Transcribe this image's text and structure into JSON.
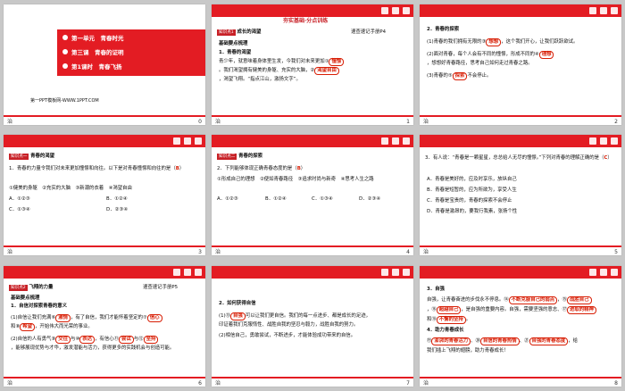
{
  "slides": [
    {
      "num": "0",
      "lines": [
        "第一单元　青春时光",
        "第三课　青春的证明",
        "第1课时　青春飞扬"
      ],
      "foot": "第一PPT模板网-WWW.1PPT.COM"
    },
    {
      "num": "1",
      "header": "夯实基础·分点训练",
      "tag": "知识点1",
      "title": "成长的渴望",
      "note": "速查速记手册P4",
      "sub": "基础要点梳理",
      "item": "1．青春的渴望",
      "body1": "青少年，就意味着身体里生发，今我们对未来更加①",
      "ans1": "憧憬",
      "body2": "。我们渴望拥有健美的身躯、充实的大脑，②",
      "ans2": "渴望自由",
      "body3": "，渴望飞翔。“指点江山，激扬文字”。"
    },
    {
      "num": "2",
      "item": "2．青春的探索",
      "l1a": "(1)青春的我们拥有无限的③",
      "l1b": "想想",
      "l1c": "，这个我们开心，让我们跃跃欲试。",
      "l2a": "(2)面对青春，每个人会有不同的憧憬，形成不同的④",
      "l2b": "理想",
      "l2c": "，想想好青春路径，思考自己如何走过青春之路。",
      "l3a": "(3)青春的⑤",
      "l3b": "探索",
      "l3c": "不会停止。"
    },
    {
      "num": "3",
      "tag": "知识点一",
      "title": "青春的渴望",
      "q": "1．青春的力量令我们对未来更加憧憬和向往。以下是对青春憧憬和向往的是（",
      "ans": "B",
      "opts": [
        "①健美的身躯　②充实的大脑　③新潮的衣着　④渴望自由",
        "A．①②③",
        "B．①②④",
        "C．①③④",
        "D．②③④"
      ]
    },
    {
      "num": "4",
      "tag": "知识点二",
      "title": "青春的探索",
      "q": "2．下列能够体现正确青春态度的是（",
      "ans": "B",
      "opts": [
        "①形成自己的理想　②便如青春路径　③追求时尚与新奇　④思考人生之路",
        "A．①②③",
        "B．①②④",
        "C．①③④",
        "D．②③④"
      ]
    },
    {
      "num": "5",
      "q": "3．有人说：“青春是一颗星星，总总给人无尽的憧憬。”下列对青春的理解正确的是（",
      "ans": "C",
      "opts": [
        "A．青春是美好的，应及时享乐，放纵自己",
        "B．青春是短暂的，应为所欲为，享受人生",
        "C．青春是宝贵的，青春的探索不会停止",
        "D．青春是激昂的，要我行我素，张扬个性"
      ]
    },
    {
      "num": "6",
      "tag": "知识点2",
      "title": "飞翔的力量",
      "note": "速查速记手册P5",
      "sub": "基础要点梳理",
      "item": "1．自信对探索青春的意义",
      "l1a": "(1)自信让我们充满⑥",
      "l1b": "激情",
      "l1c": "，有了自信，我们才能怀着坚定的⑦",
      "l1d": "信心",
      "l2a": "和⑧",
      "l2b": "希望",
      "l2c": "，开始伟大而光荣的事业。",
      "l3a": "(2)自信的人有勇气⑨",
      "l3b": "交往",
      "l3c": "与⑩",
      "l3d": "表达",
      "l3e": "，有信心⑪",
      "l3f": "尝试",
      "l3g": "与⑫",
      "l3h": "坚持",
      "l4": "，能够展现优势与才华，激发潜能与活力，获得更多的实践机会与创造可能。"
    },
    {
      "num": "7",
      "item": "2．如何获得自信",
      "l1a": "(1)⑬",
      "l1b": "自强",
      "l1c": "可以让我们更自信。我们的每一点进步、都是成长的足迹，",
      "l2": "印证着我们克服惰性、战胜自我的坚忍与毅力，战胜自我的努力。",
      "l3": "(2)相信自己，勇敢尝试，不断进步，才能体验成功带来的自信。"
    },
    {
      "num": "8",
      "item": "3．自强",
      "l1a": "自强，让青春奋进的步伐永不停息。⑭",
      "l1b": "不断克服自己的弱点",
      "l1c": "，⑮",
      "l1d": "战胜自己",
      "l2a": "，⑯",
      "l2b": "超越自己",
      "l2c": "，是自强的重要内容。自强，需要坚强的意志、⑰",
      "l2d": "进取的精神",
      "l3a": "和⑱",
      "l3b": "不懈的坚持",
      "l3c": "。",
      "item2": "4．助力青春成长",
      "l4a": "⑲",
      "l4b": "澎湃的青春活力",
      "l4c": "、⑳",
      "l4d": "自信的青春热情",
      "l4e": "、㉑",
      "l4f": "自强的青春态度",
      "l4g": "，给",
      "l5": "我们插上飞翔的翅膀，助力青春成长！"
    }
  ],
  "bottom_left": "治"
}
